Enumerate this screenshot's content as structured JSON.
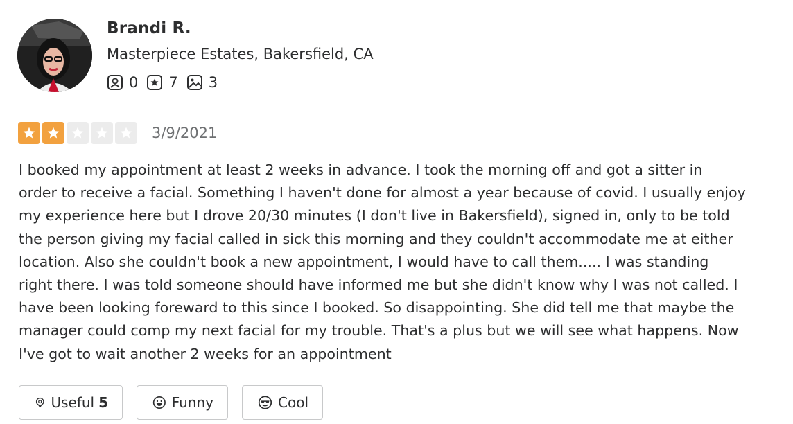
{
  "user": {
    "name": "Brandi R.",
    "location": "Masterpiece Estates, Bakersfield, CA",
    "stats": {
      "friends": "0",
      "reviews": "7",
      "photos": "3"
    }
  },
  "review": {
    "rating": 2,
    "max_rating": 5,
    "date": "3/9/2021",
    "text": "I booked my appointment at least 2 weeks in advance. I took the morning off and got a sitter in\norder to receive a facial. Something I haven't done for almost a year because of covid. I usually enjoy\nmy experience here but I drove 20/30 minutes (I don't live in Bakersfield), signed in, only to be told\nthe person giving my facial called in sick this morning and they couldn't accommodate me at either\nlocation.  Also she couldn't book a new appointment, I would have to call them.....  I was standing\nright there. I was told someone should have informed me but she didn't know why I was not called. I\nhave been looking foreward to this since I booked.  So disappointing. She did tell me that maybe the\nmanager could comp my next facial for my trouble. That's a plus but we will see what happens. Now\nI've got to wait another 2 weeks for an appointment"
  },
  "reactions": {
    "useful_label": "Useful",
    "useful_count": "5",
    "funny_label": "Funny",
    "cool_label": "Cool"
  },
  "colors": {
    "star_filled": "#f2a13f",
    "star_empty": "#ececec",
    "text": "#2d2e2f",
    "muted": "#6e7072"
  },
  "icons": {
    "friends": "friends-icon",
    "reviews": "review-star-icon",
    "photos": "photo-icon",
    "useful": "lightbulb-icon",
    "funny": "smile-icon",
    "cool": "sunglasses-icon"
  }
}
